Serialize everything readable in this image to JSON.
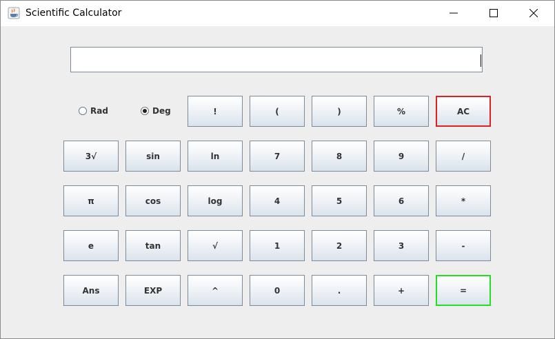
{
  "window": {
    "title": "Scientific Calculator",
    "app_icon": "java-icon",
    "controls": [
      "minimize-icon",
      "maximize-icon",
      "close-icon"
    ]
  },
  "display": {
    "value": ""
  },
  "angle_mode": {
    "options": [
      {
        "label": "Rad",
        "selected": false
      },
      {
        "label": "Deg",
        "selected": true
      }
    ]
  },
  "buttons": {
    "factorial": "!",
    "open_paren": "(",
    "close_paren": ")",
    "percent": "%",
    "clear": "AC",
    "cube_root": "3√",
    "sin": "sin",
    "ln": "ln",
    "seven": "7",
    "eight": "8",
    "nine": "9",
    "divide": "/",
    "pi": "π",
    "cos": "cos",
    "log": "log",
    "four": "4",
    "five": "5",
    "six": "6",
    "multiply": "*",
    "e": "e",
    "tan": "tan",
    "sqrt": "√",
    "one": "1",
    "two": "2",
    "three": "3",
    "minus": "-",
    "ans": "Ans",
    "exp": "EXP",
    "power": "^",
    "zero": "0",
    "decimal": ".",
    "plus": "+",
    "equals": "="
  },
  "colors": {
    "clear_border": "#e02020",
    "equals_border": "#20e020"
  }
}
